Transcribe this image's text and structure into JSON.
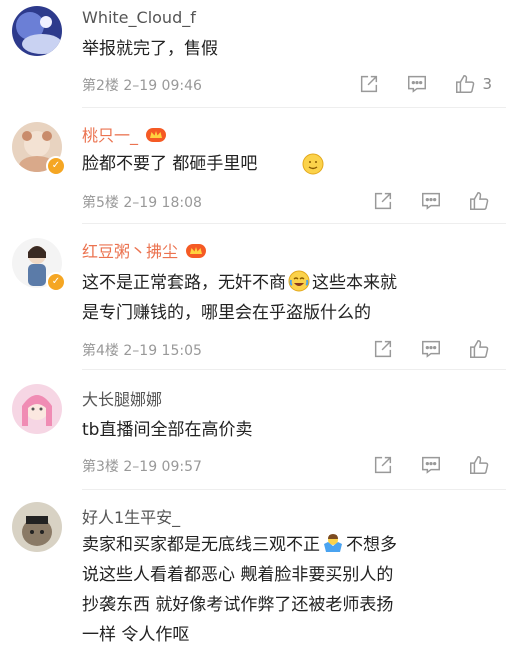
{
  "colors": {
    "username_highlight": "#eb7350",
    "username_normal": "#555555",
    "meta": "#999999",
    "vip_badge": "#f5a623"
  },
  "comments": [
    {
      "username": "White_Cloud_f",
      "text": "举报就完了，售假",
      "floor": "第2楼",
      "time": "2–19 09:46",
      "like_count": "3"
    },
    {
      "username": "桃只一_",
      "text": "脸都不要了 都砸手里吧",
      "floor": "第5楼",
      "time": "2–19 18:08",
      "like_count": ""
    },
    {
      "username": "红豆粥丶拂尘",
      "text_a": "这不是正常套路，无奸不商",
      "text_b": "这些本来就",
      "text_c": "是专门赚钱的，哪里会在乎盗版什么的",
      "floor": "第4楼",
      "time": "2–19 15:05",
      "like_count": ""
    },
    {
      "username": "大长腿娜娜",
      "text": "tb直播间全部在高价卖",
      "floor": "第3楼",
      "time": "2–19 09:57",
      "like_count": ""
    },
    {
      "username": "好人1生平安_",
      "text_a": "卖家和买家都是无底线三观不正",
      "text_b": "不想多",
      "text_c": "说这些人看着都恶心  觍着脸非要买别人的",
      "text_d": "抄袭东西  就好像考试作弊了还被老师表扬",
      "text_e": "一样  令人作呕"
    }
  ],
  "icons": {
    "share": "share-icon",
    "comment": "comment-icon",
    "like": "thumbs-up-icon",
    "vip": "crown-icon",
    "verified": "verified-badge-icon"
  }
}
